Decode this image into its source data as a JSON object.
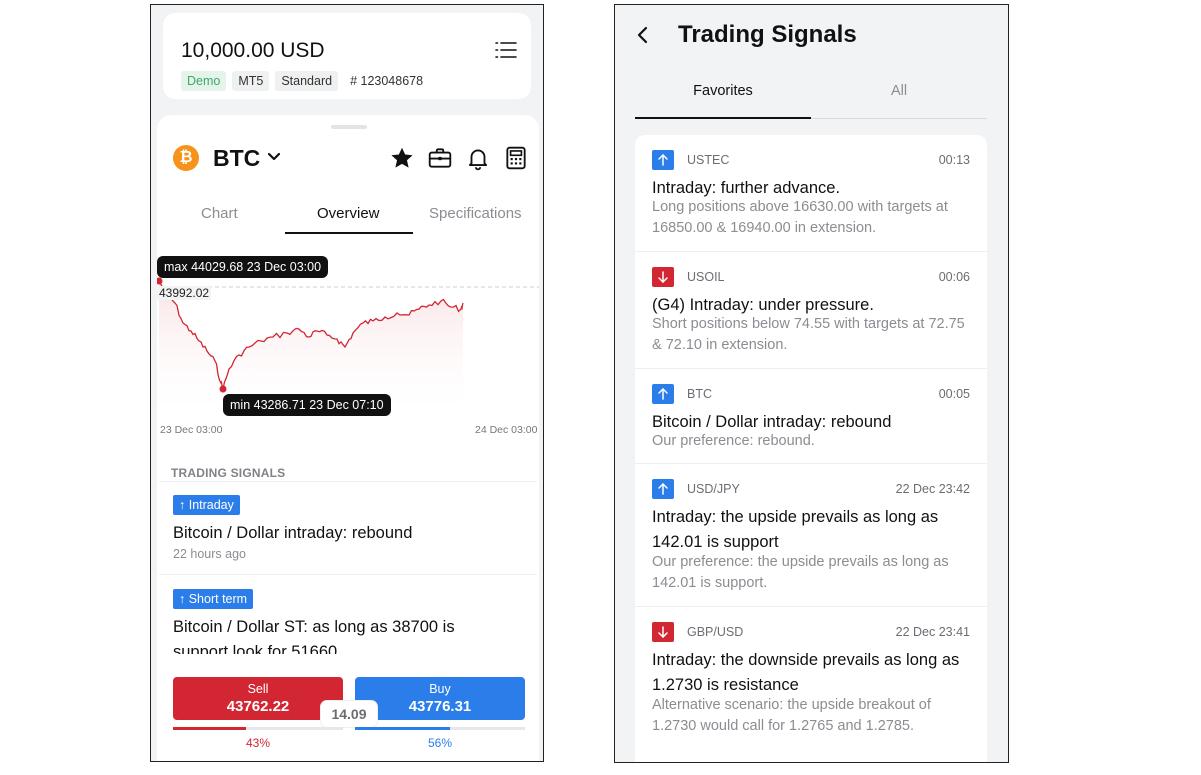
{
  "left": {
    "account": {
      "balance": "10,000.00 USD",
      "badges": [
        "Demo",
        "MT5",
        "Standard"
      ],
      "account_number": "# 123048678"
    },
    "symbol": {
      "name": "BTC",
      "coin_glyph": "₿",
      "coin_color": "#f7931a"
    },
    "tabs": [
      {
        "label": "Chart",
        "active": false
      },
      {
        "label": "Overview",
        "active": true
      },
      {
        "label": "Specifications",
        "active": false
      }
    ],
    "chart": {
      "max_label": "max 44029.68 23 Dec 03:00",
      "min_label": "min 43286.71 23 Dec 07:10",
      "current_price_label": "43992.02",
      "x_start_label": "23 Dec 03:00",
      "x_end_label": "24 Dec 03:00",
      "line_color": "#d22633"
    },
    "signals_section_title": "TRADING SIGNALS",
    "signals": [
      {
        "tag": "↑ Intraday",
        "title": "Bitcoin / Dollar intraday: rebound",
        "sub": "22 hours ago"
      },
      {
        "tag": "↑ Short term",
        "title": "Bitcoin / Dollar ST: as long as 38700 is support look for 51660",
        "sub": ""
      }
    ],
    "trade": {
      "sell_label": "Sell",
      "sell_price": "43762.22",
      "buy_label": "Buy",
      "buy_price": "43776.31",
      "spread": "14.09",
      "sell_pct": "43%",
      "buy_pct": "56%",
      "sell_fraction": 0.43,
      "buy_fraction": 0.56,
      "sell_color": "#d22633",
      "buy_color": "#2b7de9"
    }
  },
  "right": {
    "title": "Trading Signals",
    "tabs": [
      {
        "label": "Favorites",
        "active": true
      },
      {
        "label": "All",
        "active": false
      }
    ],
    "signals": [
      {
        "direction": "up",
        "symbol": "USTEC",
        "time": "00:13",
        "title": "Intraday: further advance.",
        "desc": "Long positions above 16630.00 with targets at 16850.00 & 16940.00 in extension."
      },
      {
        "direction": "down",
        "symbol": "USOIL",
        "time": "00:06",
        "title": "(G4) Intraday: under pressure.",
        "desc": "Short positions below 74.55 with targets at 72.75 & 72.10 in extension."
      },
      {
        "direction": "up",
        "symbol": "BTC",
        "time": "00:05",
        "title": "Bitcoin / Dollar intraday: rebound",
        "desc": "Our preference: rebound."
      },
      {
        "direction": "up",
        "symbol": "USD/JPY",
        "time": "22 Dec 23:42",
        "title": "Intraday: the upside prevails as long as 142.01 is support",
        "desc": "Our preference: the upside prevails as long as 142.01 is support."
      },
      {
        "direction": "down",
        "symbol": "GBP/USD",
        "time": "22 Dec 23:41",
        "title": "Intraday: the downside prevails as long as 1.2730 is resistance",
        "desc": "Alternative scenario: the upside breakout of 1.2730 would call for 1.2765 and 1.2785."
      }
    ]
  }
}
